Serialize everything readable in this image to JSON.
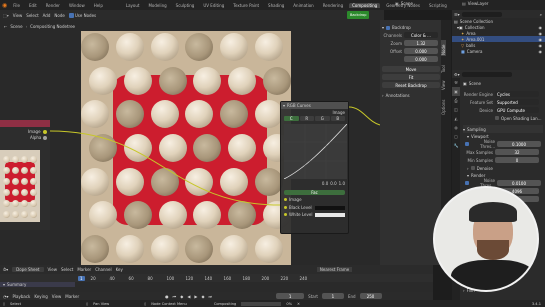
{
  "window": {
    "title": "Scene",
    "viewlayer": "ViewLayer"
  },
  "menubar": {
    "menus": [
      "File",
      "Edit",
      "Render",
      "Window",
      "Help"
    ],
    "workspaces": [
      "Layout",
      "Modeling",
      "Sculpting",
      "UV Editing",
      "Texture Paint",
      "Shading",
      "Animation",
      "Rendering",
      "Compositing",
      "Geometry Nodes",
      "Scripting"
    ],
    "active_workspace": "Compositing"
  },
  "node_editor": {
    "header_menus": [
      "View",
      "Select",
      "Add",
      "Node"
    ],
    "use_nodes_label": "Use Nodes",
    "backdrop_label": "Backdrop",
    "breadcrumb": [
      "Scene",
      "Compositing Nodetree"
    ],
    "left_node_sockets": [
      "Image",
      "Alpha"
    ],
    "rgb_curves": {
      "title": "RGB Curves",
      "image_out": "Image",
      "tabs": [
        "C",
        "R",
        "G",
        "B"
      ],
      "channel_values": [
        "0.0",
        "0.0",
        "1.0"
      ],
      "inputs": [
        "Fac",
        "Image",
        "Black Level",
        "White Level"
      ]
    }
  },
  "n_panel": {
    "tabs": [
      "Node",
      "Tool",
      "View",
      "Options"
    ],
    "backdrop": {
      "title": "Backdrop",
      "channels_label": "Channels",
      "channels_value": "Color & ...",
      "zoom_label": "Zoom",
      "zoom_value": "1.32",
      "offset_label": "Offset",
      "offset_x": "0.000",
      "offset_y": "0.000",
      "move_button": "Move",
      "fit_button": "Fit",
      "reset_button": "Reset Backdrop"
    },
    "annotations_label": "Annotations"
  },
  "outliner": {
    "items": [
      "Scene Collection",
      "Collection",
      "Area",
      "Area.001",
      "balls",
      "Camera"
    ]
  },
  "properties": {
    "search_placeholder": "",
    "scene_label": "Scene",
    "render_engine_label": "Render Engine",
    "render_engine_value": "Cycles",
    "feature_set_label": "Feature Set",
    "feature_set_value": "Supported",
    "device_label": "Device",
    "device_value": "GPU Compute",
    "open_shading_label": "Open Shading Lan...",
    "sampling_label": "Sampling",
    "viewport_label": "Viewport",
    "noise_threshold_label": "Noise Thres...",
    "noise_threshold_value": "0.1000",
    "max_samples_label": "Max Samples",
    "max_samples_value": "32",
    "min_samples_label": "Min Samples",
    "min_samples_value": "0",
    "denoise_label": "Denoise",
    "render_label": "Render",
    "render_noise_label": "Noise Thres...",
    "render_noise_value": "0.0100",
    "render_max_label": "Max Samples",
    "render_max_value": "4096",
    "time_limit_value": "0 s",
    "film_label": "Film"
  },
  "timeline": {
    "editor_label": "Dope Sheet",
    "header_menus": [
      "View",
      "Select",
      "Marker",
      "Channel",
      "Key"
    ],
    "only_show_label": "Summary",
    "interpolation_label": "Nearest Frame",
    "frame_numbers": [
      "0",
      "20",
      "40",
      "60",
      "80",
      "100",
      "120",
      "140",
      "160",
      "180",
      "200",
      "220",
      "240"
    ],
    "current_frame": "1",
    "summary_label": "Summary"
  },
  "playback_bar": {
    "playback_label": "Playback",
    "keying_label": "Keying",
    "view_label": "View",
    "marker_label": "Marker",
    "frame_value": "1",
    "start_label": "Start",
    "start_value": "1",
    "end_label": "End",
    "end_value": "250"
  },
  "statusbar": {
    "select_label": "Select",
    "pan_label": "Pan View",
    "context_label": "Node Context Menu",
    "compositing_label": "Compositing",
    "progress_percent": 0,
    "progress_label": "0%",
    "version": "3.4.1"
  },
  "colors": {
    "accent": "#4772b3",
    "green": "#2c8a2c",
    "red_bg": "#cc1d2e"
  }
}
